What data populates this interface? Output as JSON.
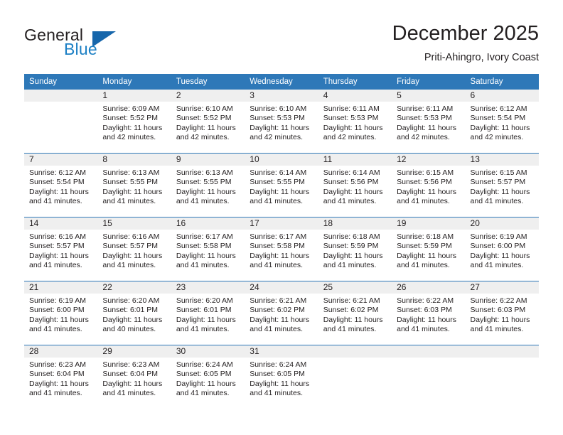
{
  "brand": {
    "name_part1": "General",
    "name_part2": "Blue",
    "triangle_color": "#1666ab",
    "blue_color": "#1b7fc4"
  },
  "header": {
    "title": "December 2025",
    "subtitle": "Priti-Ahingro, Ivory Coast"
  },
  "theme": {
    "header_blue": "#2e78b8",
    "daynum_gray": "#efefef",
    "text": "#231f20"
  },
  "weekdays": [
    "Sunday",
    "Monday",
    "Tuesday",
    "Wednesday",
    "Thursday",
    "Friday",
    "Saturday"
  ],
  "weeks": [
    [
      {
        "day": "",
        "sunrise": "",
        "sunset": "",
        "daylight1": "",
        "daylight2": ""
      },
      {
        "day": "1",
        "sunrise": "Sunrise: 6:09 AM",
        "sunset": "Sunset: 5:52 PM",
        "daylight1": "Daylight: 11 hours",
        "daylight2": "and 42 minutes."
      },
      {
        "day": "2",
        "sunrise": "Sunrise: 6:10 AM",
        "sunset": "Sunset: 5:52 PM",
        "daylight1": "Daylight: 11 hours",
        "daylight2": "and 42 minutes."
      },
      {
        "day": "3",
        "sunrise": "Sunrise: 6:10 AM",
        "sunset": "Sunset: 5:53 PM",
        "daylight1": "Daylight: 11 hours",
        "daylight2": "and 42 minutes."
      },
      {
        "day": "4",
        "sunrise": "Sunrise: 6:11 AM",
        "sunset": "Sunset: 5:53 PM",
        "daylight1": "Daylight: 11 hours",
        "daylight2": "and 42 minutes."
      },
      {
        "day": "5",
        "sunrise": "Sunrise: 6:11 AM",
        "sunset": "Sunset: 5:53 PM",
        "daylight1": "Daylight: 11 hours",
        "daylight2": "and 42 minutes."
      },
      {
        "day": "6",
        "sunrise": "Sunrise: 6:12 AM",
        "sunset": "Sunset: 5:54 PM",
        "daylight1": "Daylight: 11 hours",
        "daylight2": "and 42 minutes."
      }
    ],
    [
      {
        "day": "7",
        "sunrise": "Sunrise: 6:12 AM",
        "sunset": "Sunset: 5:54 PM",
        "daylight1": "Daylight: 11 hours",
        "daylight2": "and 41 minutes."
      },
      {
        "day": "8",
        "sunrise": "Sunrise: 6:13 AM",
        "sunset": "Sunset: 5:55 PM",
        "daylight1": "Daylight: 11 hours",
        "daylight2": "and 41 minutes."
      },
      {
        "day": "9",
        "sunrise": "Sunrise: 6:13 AM",
        "sunset": "Sunset: 5:55 PM",
        "daylight1": "Daylight: 11 hours",
        "daylight2": "and 41 minutes."
      },
      {
        "day": "10",
        "sunrise": "Sunrise: 6:14 AM",
        "sunset": "Sunset: 5:55 PM",
        "daylight1": "Daylight: 11 hours",
        "daylight2": "and 41 minutes."
      },
      {
        "day": "11",
        "sunrise": "Sunrise: 6:14 AM",
        "sunset": "Sunset: 5:56 PM",
        "daylight1": "Daylight: 11 hours",
        "daylight2": "and 41 minutes."
      },
      {
        "day": "12",
        "sunrise": "Sunrise: 6:15 AM",
        "sunset": "Sunset: 5:56 PM",
        "daylight1": "Daylight: 11 hours",
        "daylight2": "and 41 minutes."
      },
      {
        "day": "13",
        "sunrise": "Sunrise: 6:15 AM",
        "sunset": "Sunset: 5:57 PM",
        "daylight1": "Daylight: 11 hours",
        "daylight2": "and 41 minutes."
      }
    ],
    [
      {
        "day": "14",
        "sunrise": "Sunrise: 6:16 AM",
        "sunset": "Sunset: 5:57 PM",
        "daylight1": "Daylight: 11 hours",
        "daylight2": "and 41 minutes."
      },
      {
        "day": "15",
        "sunrise": "Sunrise: 6:16 AM",
        "sunset": "Sunset: 5:57 PM",
        "daylight1": "Daylight: 11 hours",
        "daylight2": "and 41 minutes."
      },
      {
        "day": "16",
        "sunrise": "Sunrise: 6:17 AM",
        "sunset": "Sunset: 5:58 PM",
        "daylight1": "Daylight: 11 hours",
        "daylight2": "and 41 minutes."
      },
      {
        "day": "17",
        "sunrise": "Sunrise: 6:17 AM",
        "sunset": "Sunset: 5:58 PM",
        "daylight1": "Daylight: 11 hours",
        "daylight2": "and 41 minutes."
      },
      {
        "day": "18",
        "sunrise": "Sunrise: 6:18 AM",
        "sunset": "Sunset: 5:59 PM",
        "daylight1": "Daylight: 11 hours",
        "daylight2": "and 41 minutes."
      },
      {
        "day": "19",
        "sunrise": "Sunrise: 6:18 AM",
        "sunset": "Sunset: 5:59 PM",
        "daylight1": "Daylight: 11 hours",
        "daylight2": "and 41 minutes."
      },
      {
        "day": "20",
        "sunrise": "Sunrise: 6:19 AM",
        "sunset": "Sunset: 6:00 PM",
        "daylight1": "Daylight: 11 hours",
        "daylight2": "and 41 minutes."
      }
    ],
    [
      {
        "day": "21",
        "sunrise": "Sunrise: 6:19 AM",
        "sunset": "Sunset: 6:00 PM",
        "daylight1": "Daylight: 11 hours",
        "daylight2": "and 41 minutes."
      },
      {
        "day": "22",
        "sunrise": "Sunrise: 6:20 AM",
        "sunset": "Sunset: 6:01 PM",
        "daylight1": "Daylight: 11 hours",
        "daylight2": "and 40 minutes."
      },
      {
        "day": "23",
        "sunrise": "Sunrise: 6:20 AM",
        "sunset": "Sunset: 6:01 PM",
        "daylight1": "Daylight: 11 hours",
        "daylight2": "and 41 minutes."
      },
      {
        "day": "24",
        "sunrise": "Sunrise: 6:21 AM",
        "sunset": "Sunset: 6:02 PM",
        "daylight1": "Daylight: 11 hours",
        "daylight2": "and 41 minutes."
      },
      {
        "day": "25",
        "sunrise": "Sunrise: 6:21 AM",
        "sunset": "Sunset: 6:02 PM",
        "daylight1": "Daylight: 11 hours",
        "daylight2": "and 41 minutes."
      },
      {
        "day": "26",
        "sunrise": "Sunrise: 6:22 AM",
        "sunset": "Sunset: 6:03 PM",
        "daylight1": "Daylight: 11 hours",
        "daylight2": "and 41 minutes."
      },
      {
        "day": "27",
        "sunrise": "Sunrise: 6:22 AM",
        "sunset": "Sunset: 6:03 PM",
        "daylight1": "Daylight: 11 hours",
        "daylight2": "and 41 minutes."
      }
    ],
    [
      {
        "day": "28",
        "sunrise": "Sunrise: 6:23 AM",
        "sunset": "Sunset: 6:04 PM",
        "daylight1": "Daylight: 11 hours",
        "daylight2": "and 41 minutes."
      },
      {
        "day": "29",
        "sunrise": "Sunrise: 6:23 AM",
        "sunset": "Sunset: 6:04 PM",
        "daylight1": "Daylight: 11 hours",
        "daylight2": "and 41 minutes."
      },
      {
        "day": "30",
        "sunrise": "Sunrise: 6:24 AM",
        "sunset": "Sunset: 6:05 PM",
        "daylight1": "Daylight: 11 hours",
        "daylight2": "and 41 minutes."
      },
      {
        "day": "31",
        "sunrise": "Sunrise: 6:24 AM",
        "sunset": "Sunset: 6:05 PM",
        "daylight1": "Daylight: 11 hours",
        "daylight2": "and 41 minutes."
      },
      {
        "day": "",
        "sunrise": "",
        "sunset": "",
        "daylight1": "",
        "daylight2": ""
      },
      {
        "day": "",
        "sunrise": "",
        "sunset": "",
        "daylight1": "",
        "daylight2": ""
      },
      {
        "day": "",
        "sunrise": "",
        "sunset": "",
        "daylight1": "",
        "daylight2": ""
      }
    ]
  ]
}
